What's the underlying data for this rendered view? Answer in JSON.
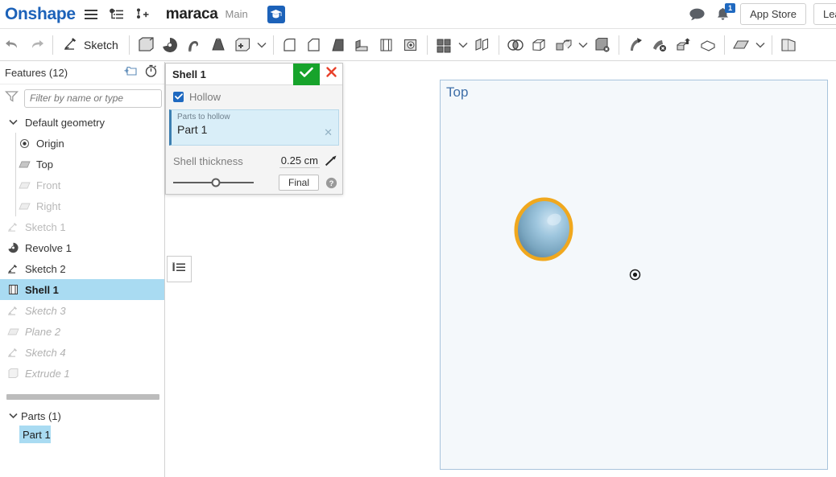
{
  "header": {
    "logo": "Onshape",
    "menu_icon": "hamburger-menu-icon",
    "versions_icon": "version-graph-icon",
    "branch_icon": "branch-add-icon",
    "doc_title": "maraca",
    "branch_name": "Main",
    "learn_tab_icon": "graduation-cap-icon",
    "comment_icon": "comment-bubble-icon",
    "notification_icon": "bell-icon",
    "notification_count": "1",
    "app_store_label": "App Store",
    "learn_label": "Lear"
  },
  "toolbar": {
    "undo_icon": "undo-arrow-icon",
    "redo_icon": "redo-arrow-icon",
    "sketch_label": "Sketch",
    "sketch_icon": "pencil-sketch-icon",
    "tools": [
      {
        "name": "extrude-tool",
        "icon": "extrude-icon"
      },
      {
        "name": "revolve-tool",
        "icon": "revolve-icon"
      },
      {
        "name": "sweep-tool",
        "icon": "sweep-icon"
      },
      {
        "name": "loft-tool",
        "icon": "loft-icon"
      },
      {
        "name": "more-solid-tools",
        "icon": "solid-box-plus-icon"
      },
      {
        "name": "fillet-tool",
        "icon": "fillet-icon"
      },
      {
        "name": "chamfer-tool",
        "icon": "chamfer-icon"
      },
      {
        "name": "draft-tool",
        "icon": "draft-icon"
      },
      {
        "name": "rib-tool",
        "icon": "rib-icon"
      },
      {
        "name": "shell-tool",
        "icon": "shell-icon"
      },
      {
        "name": "hole-tool",
        "icon": "hole-icon"
      },
      {
        "name": "pattern-tool",
        "icon": "linear-pattern-icon"
      },
      {
        "name": "mirror-tool",
        "icon": "mirror-icon"
      },
      {
        "name": "boolean-tool",
        "icon": "boolean-union-icon"
      },
      {
        "name": "split-tool",
        "icon": "split-icon"
      },
      {
        "name": "transform-tool",
        "icon": "transform-icon"
      },
      {
        "name": "move-face-tool",
        "icon": "move-face-icon"
      },
      {
        "name": "delete-face-tool",
        "icon": "delete-face-icon"
      },
      {
        "name": "replace-face-tool",
        "icon": "replace-face-icon"
      },
      {
        "name": "delete-part-tool",
        "icon": "delete-part-icon"
      },
      {
        "name": "enclose-tool",
        "icon": "enclose-icon"
      },
      {
        "name": "plane-tool",
        "icon": "plane-icon"
      },
      {
        "name": "sheet-metal-tool",
        "icon": "sheet-metal-icon"
      }
    ]
  },
  "features_panel": {
    "title": "Features (12)",
    "folder_icon": "new-folder-icon",
    "history_icon": "stopwatch-icon",
    "filter_icon": "funnel-filter-icon",
    "filter_placeholder": "Filter by name or type",
    "tree": [
      {
        "label": "Default geometry",
        "icon": "chevron-down-icon",
        "state": "group"
      },
      {
        "label": "Origin",
        "icon": "origin-icon",
        "state": "normal"
      },
      {
        "label": "Top",
        "icon": "plane-icon",
        "state": "normal"
      },
      {
        "label": "Front",
        "icon": "plane-icon",
        "state": "dim"
      },
      {
        "label": "Right",
        "icon": "plane-icon",
        "state": "dim"
      },
      {
        "label": "Sketch 1",
        "icon": "pencil-sketch-icon",
        "state": "dim"
      },
      {
        "label": "Revolve 1",
        "icon": "revolve-icon",
        "state": "normal"
      },
      {
        "label": "Sketch 2",
        "icon": "pencil-sketch-icon",
        "state": "normal"
      },
      {
        "label": "Shell 1",
        "icon": "shell-icon",
        "state": "selected"
      },
      {
        "label": "Sketch 3",
        "icon": "pencil-sketch-icon",
        "state": "rolledback"
      },
      {
        "label": "Plane 2",
        "icon": "plane-icon",
        "state": "rolledback"
      },
      {
        "label": "Sketch 4",
        "icon": "pencil-sketch-icon",
        "state": "rolledback"
      },
      {
        "label": "Extrude 1",
        "icon": "extrude-icon",
        "state": "rolledback"
      }
    ],
    "parts_title": "Parts (1)",
    "parts_chevron": "chevron-down-icon",
    "parts": [
      "Part 1"
    ]
  },
  "shell_dialog": {
    "title": "Shell 1",
    "ok_icon": "checkmark-icon",
    "cancel_icon": "close-x-icon",
    "hollow_label": "Hollow",
    "hollow_checked": true,
    "parts_field_label": "Parts to hollow",
    "parts_field_value": "Part 1",
    "parts_clear_icon": "clear-x-icon",
    "thickness_label": "Shell thickness",
    "thickness_value": "0.25 cm",
    "flip_icon": "flip-direction-arrow-icon",
    "slider_percent": 53,
    "final_label": "Final",
    "help_icon": "help-question-icon"
  },
  "list_toggle": {
    "icon": "feature-list-toggle-icon"
  },
  "viewport": {
    "plane_label": "Top",
    "origin_icon": "origin-target-icon",
    "part_name": "Part 1",
    "part_highlight_color": "#f5a623",
    "part_fill_color": "#8fbcd8",
    "plane_border_color": "#a8c3dc",
    "plane_fill_color": "#f4f8fb"
  }
}
